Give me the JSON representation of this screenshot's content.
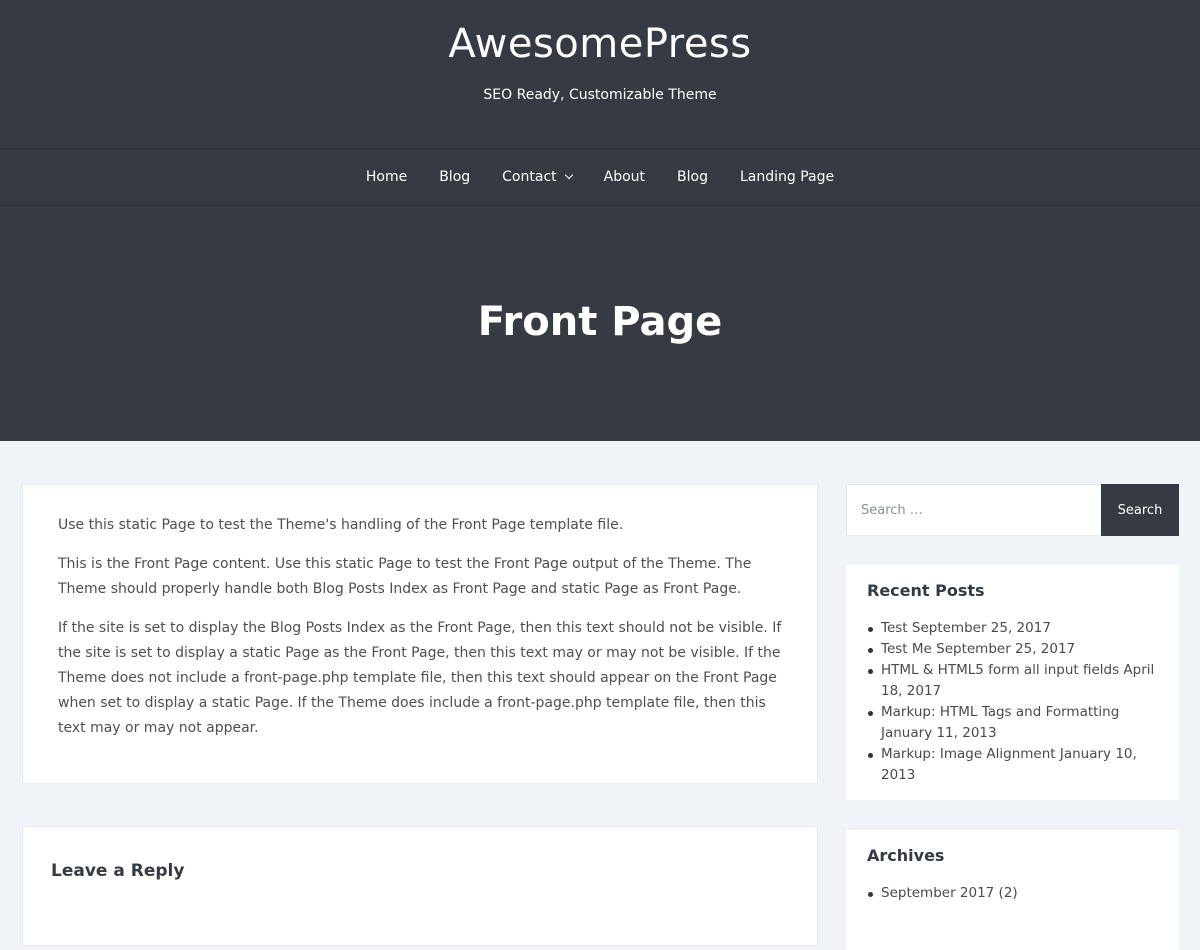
{
  "header": {
    "site_title": "AwesomePress",
    "site_description": "SEO Ready, Customizable Theme"
  },
  "nav": {
    "items": [
      {
        "label": "Home",
        "has_dropdown": false
      },
      {
        "label": "Blog",
        "has_dropdown": false
      },
      {
        "label": "Contact",
        "has_dropdown": true
      },
      {
        "label": "About",
        "has_dropdown": false
      },
      {
        "label": "Blog",
        "has_dropdown": false
      },
      {
        "label": "Landing Page",
        "has_dropdown": false
      }
    ]
  },
  "page": {
    "title": "Front Page",
    "paragraphs": [
      "Use this static Page to test the Theme's handling of the Front Page template file.",
      "This is the Front Page content. Use this static Page to test the Front Page output of the Theme. The Theme should properly handle both Blog Posts Index as Front Page and static Page as Front Page.",
      "If the site is set to display the Blog Posts Index as the Front Page, then this text should not be visible. If the site is set to display a static Page as the Front Page, then this text may or may not be visible. If the Theme does not include a front-page.php template file, then this text should appear on the Front Page when set to display a static Page. If the Theme does include a front-page.php template file, then this text may or may not appear."
    ]
  },
  "comments": {
    "heading": "Leave a Reply"
  },
  "sidebar": {
    "search": {
      "placeholder": "Search …",
      "value": "",
      "button_label": "Search"
    },
    "recent_posts": {
      "title": "Recent Posts",
      "items": [
        "Test September 25, 2017",
        "Test Me September 25, 2017",
        "HTML & HTML5 form all input fields April 18, 2017",
        "Markup: HTML Tags and Formatting January 11, 2013",
        "Markup: Image Alignment January 10, 2013"
      ]
    },
    "archives": {
      "title": "Archives",
      "items": [
        "September 2017 (2)"
      ]
    }
  },
  "colors": {
    "header_bg": "#353a43",
    "page_bg": "#f0f3f7",
    "card_bg": "#ffffff",
    "button_bg": "#353a43"
  }
}
